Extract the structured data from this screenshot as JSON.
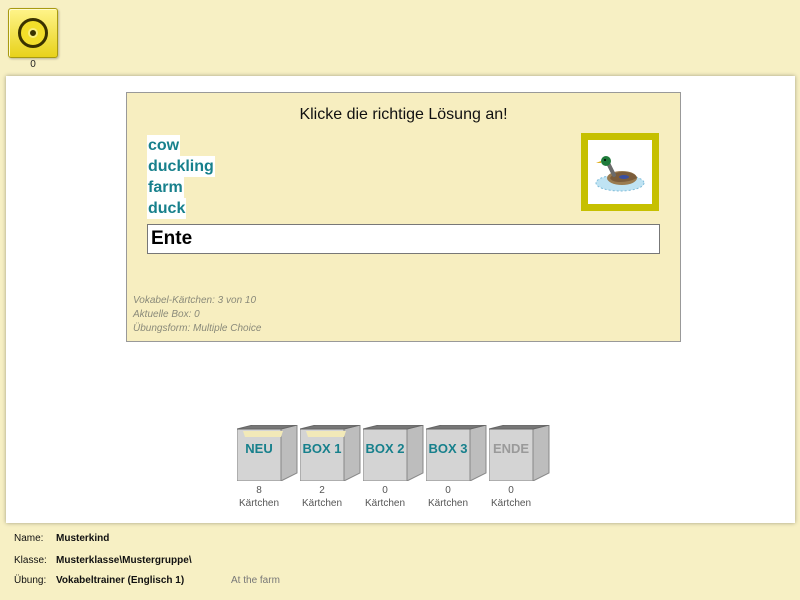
{
  "top": {
    "counter": "0"
  },
  "card": {
    "title": "Klicke die richtige Lösung an!",
    "options": [
      "cow",
      "duckling",
      "farm",
      "duck"
    ],
    "answer": "Ente",
    "meta": {
      "cards": "Vokabel-Kärtchen: 3 von 10",
      "box": "Aktuelle Box: 0",
      "mode": "Übungsform: Multiple Choice"
    },
    "image_icon": "duck-picture"
  },
  "boxes": [
    {
      "label": "NEU",
      "count": "8",
      "unit": "Kärtchen",
      "filled": true
    },
    {
      "label": "BOX 1",
      "count": "2",
      "unit": "Kärtchen",
      "filled": true
    },
    {
      "label": "BOX 2",
      "count": "0",
      "unit": "Kärtchen",
      "filled": false
    },
    {
      "label": "BOX 3",
      "count": "0",
      "unit": "Kärtchen",
      "filled": false
    },
    {
      "label": "ENDE",
      "count": "0",
      "unit": "Kärtchen",
      "filled": false
    }
  ],
  "footer": {
    "name_key": "Name:",
    "name": "Musterkind",
    "class_key": "Klasse:",
    "class": "Musterklasse\\Mustergruppe\\",
    "exercise_key": "Übung:",
    "exercise": "Vokabeltrainer (Englisch 1)",
    "topic": "At the farm"
  },
  "colors": {
    "accent": "#17808c",
    "background": "#f7f0c4",
    "card": "#f7eec0",
    "frame": "#c6c000"
  }
}
